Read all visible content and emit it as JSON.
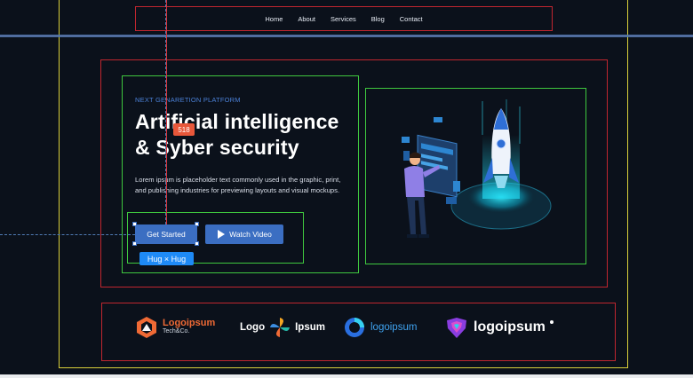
{
  "nav": {
    "items": [
      "Home",
      "About",
      "Services",
      "Blog",
      "Contact"
    ]
  },
  "hero": {
    "eyebrow": "NEXT GENARETION PLATFORM",
    "title": "Artificial intelligence\n& Syber security",
    "paragraph": "Lorem ipsum is placeholder text commonly used in the graphic, print, and publishing industries for previewing layouts and visual mockups.",
    "primary_button": "Get Started",
    "secondary_button": "Watch Video"
  },
  "overlay": {
    "dimension_badge": "518",
    "size_tag": "Hug × Hug"
  },
  "logos": [
    {
      "name": "Logoipsum",
      "sub": "Tech&Co.",
      "icon": "hexagon-logo-icon"
    },
    {
      "left": "Logo",
      "right": "Ipsum",
      "icon": "pinwheel-logo-icon"
    },
    {
      "name": "logoipsum",
      "icon": "ring-logo-icon"
    },
    {
      "name": "logoipsum",
      "icon": "heart-logo-icon"
    }
  ],
  "colors": {
    "background": "#0b111b",
    "accent": "#3b6ec2",
    "guide_red": "#c0262f",
    "guide_green": "#3fc83f",
    "guide_yellow": "#d9cf3a",
    "badge": "#e8573a",
    "tag": "#1e8af6"
  }
}
